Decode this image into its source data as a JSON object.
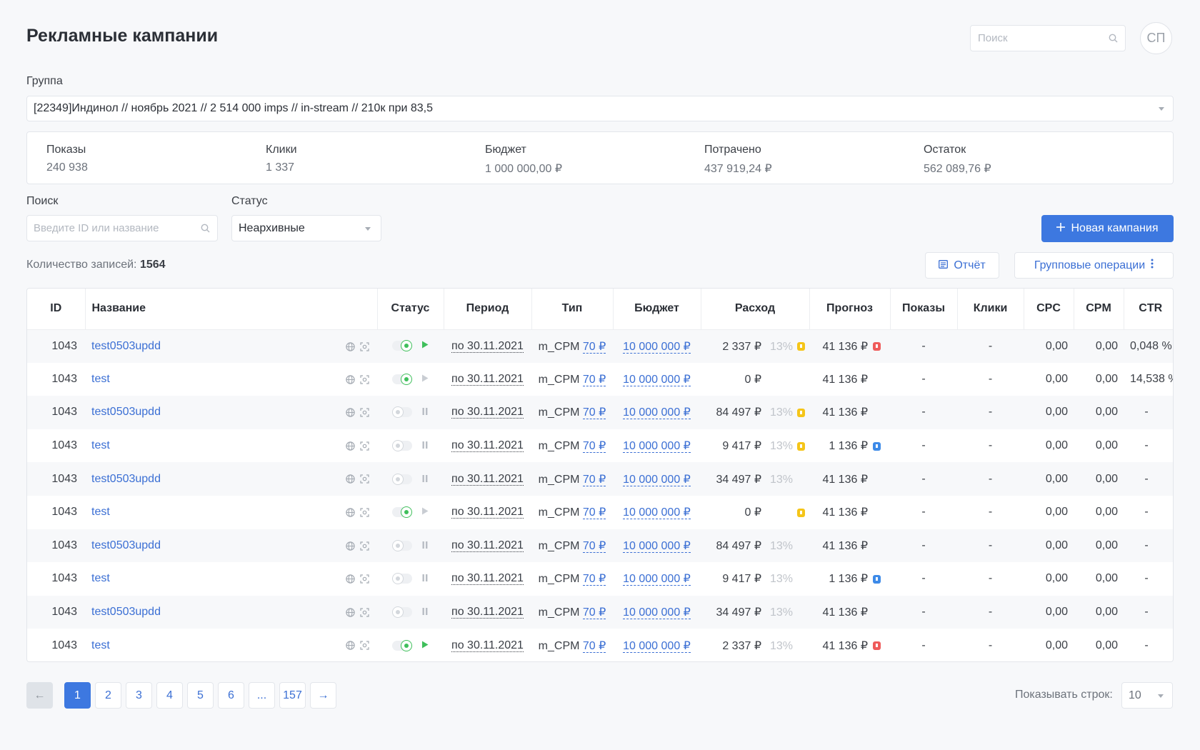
{
  "page": {
    "title": "Рекламные кампании"
  },
  "header": {
    "search_placeholder": "Поиск",
    "avatar_initials": "СП"
  },
  "group": {
    "label": "Группа",
    "value": "[22349]Индинол // ноябрь 2021 // 2 514 000 imps // in-stream // 210к при 83,5"
  },
  "stats": [
    {
      "label": "Показы",
      "value": "240 938"
    },
    {
      "label": "Клики",
      "value": "1 337"
    },
    {
      "label": "Бюджет",
      "value": "1 000 000,00 ₽"
    },
    {
      "label": "Потрачено",
      "value": "437 919,24 ₽"
    },
    {
      "label": "Остаток",
      "value": "562 089,76 ₽"
    }
  ],
  "filters": {
    "search_label": "Поиск",
    "search_placeholder": "Введите ID или название",
    "status_label": "Статус",
    "status_value": "Неархивные"
  },
  "actions": {
    "new_campaign": "Новая кампания",
    "report": "Отчёт",
    "group_ops": "Групповые операции"
  },
  "records": {
    "label": "Количество записей:",
    "count": "1564"
  },
  "table": {
    "columns": [
      "ID",
      "Название",
      "Статус",
      "Период",
      "Тип",
      "Бюджет",
      "Расход",
      "Прогноз",
      "Показы",
      "Клики",
      "CPC",
      "CPM",
      "CTR"
    ],
    "rows": [
      {
        "id": "1043",
        "name": "test0503updd",
        "active": true,
        "state": "play",
        "period": "по 30.11.2021",
        "type": "m_CPM",
        "rate": "70 ₽",
        "budget": "10 000 000 ₽",
        "spend": "2 337 ₽",
        "pct": "13%",
        "spend_flag": "yellow",
        "forecast": "41 136 ₽",
        "forecast_flag": "red",
        "shows": "-",
        "clicks": "-",
        "cpc": "0,00",
        "cpm": "0,00",
        "ctr": "0,048 %"
      },
      {
        "id": "1043",
        "name": "test",
        "active": true,
        "state": "play-muted",
        "period": "по 30.11.2021",
        "type": "m_CPM",
        "rate": "70 ₽",
        "budget": "10 000 000 ₽",
        "spend": "0 ₽",
        "pct": "",
        "spend_flag": "",
        "forecast": "41 136 ₽",
        "forecast_flag": "",
        "shows": "-",
        "clicks": "-",
        "cpc": "0,00",
        "cpm": "0,00",
        "ctr": "14,538 %"
      },
      {
        "id": "1043",
        "name": "test0503updd",
        "active": false,
        "state": "pause",
        "period": "по 30.11.2021",
        "type": "m_CPM",
        "rate": "70 ₽",
        "budget": "10 000 000 ₽",
        "spend": "84 497 ₽",
        "pct": "13%",
        "spend_flag": "yellow",
        "forecast": "41 136 ₽",
        "forecast_flag": "",
        "shows": "-",
        "clicks": "-",
        "cpc": "0,00",
        "cpm": "0,00",
        "ctr": "-"
      },
      {
        "id": "1043",
        "name": "test",
        "active": false,
        "state": "pause",
        "period": "по 30.11.2021",
        "type": "m_CPM",
        "rate": "70 ₽",
        "budget": "10 000 000 ₽",
        "spend": "9 417 ₽",
        "pct": "13%",
        "spend_flag": "yellow",
        "forecast": "1 136 ₽",
        "forecast_flag": "blue",
        "shows": "-",
        "clicks": "-",
        "cpc": "0,00",
        "cpm": "0,00",
        "ctr": "-"
      },
      {
        "id": "1043",
        "name": "test0503updd",
        "active": false,
        "state": "pause",
        "period": "по 30.11.2021",
        "type": "m_CPM",
        "rate": "70 ₽",
        "budget": "10 000 000 ₽",
        "spend": "34 497 ₽",
        "pct": "13%",
        "spend_flag": "",
        "forecast": "41 136 ₽",
        "forecast_flag": "",
        "shows": "-",
        "clicks": "-",
        "cpc": "0,00",
        "cpm": "0,00",
        "ctr": "-"
      },
      {
        "id": "1043",
        "name": "test",
        "active": true,
        "state": "play-muted",
        "period": "по 30.11.2021",
        "type": "m_CPM",
        "rate": "70 ₽",
        "budget": "10 000 000 ₽",
        "spend": "0 ₽",
        "pct": "",
        "spend_flag": "yellow",
        "forecast": "41 136 ₽",
        "forecast_flag": "",
        "shows": "-",
        "clicks": "-",
        "cpc": "0,00",
        "cpm": "0,00",
        "ctr": "-"
      },
      {
        "id": "1043",
        "name": "test0503updd",
        "active": false,
        "state": "pause",
        "period": "по 30.11.2021",
        "type": "m_CPM",
        "rate": "70 ₽",
        "budget": "10 000 000 ₽",
        "spend": "84 497 ₽",
        "pct": "13%",
        "spend_flag": "",
        "forecast": "41 136 ₽",
        "forecast_flag": "",
        "shows": "-",
        "clicks": "-",
        "cpc": "0,00",
        "cpm": "0,00",
        "ctr": "-"
      },
      {
        "id": "1043",
        "name": "test",
        "active": false,
        "state": "pause",
        "period": "по 30.11.2021",
        "type": "m_CPM",
        "rate": "70 ₽",
        "budget": "10 000 000 ₽",
        "spend": "9 417 ₽",
        "pct": "13%",
        "spend_flag": "",
        "forecast": "1 136 ₽",
        "forecast_flag": "blue",
        "shows": "-",
        "clicks": "-",
        "cpc": "0,00",
        "cpm": "0,00",
        "ctr": "-"
      },
      {
        "id": "1043",
        "name": "test0503updd",
        "active": false,
        "state": "pause",
        "period": "по 30.11.2021",
        "type": "m_CPM",
        "rate": "70 ₽",
        "budget": "10 000 000 ₽",
        "spend": "34 497 ₽",
        "pct": "13%",
        "spend_flag": "",
        "forecast": "41 136 ₽",
        "forecast_flag": "",
        "shows": "-",
        "clicks": "-",
        "cpc": "0,00",
        "cpm": "0,00",
        "ctr": "-"
      },
      {
        "id": "1043",
        "name": "test",
        "active": true,
        "state": "play",
        "period": "по 30.11.2021",
        "type": "m_CPM",
        "rate": "70 ₽",
        "budget": "10 000 000 ₽",
        "spend": "2 337 ₽",
        "pct": "13%",
        "spend_flag": "",
        "forecast": "41 136 ₽",
        "forecast_flag": "red",
        "shows": "-",
        "clicks": "-",
        "cpc": "0,00",
        "cpm": "0,00",
        "ctr": "-"
      }
    ]
  },
  "pagination": {
    "prev": "←",
    "next": "→",
    "pages": [
      "1",
      "2",
      "3",
      "4",
      "5",
      "6",
      "...",
      "157"
    ],
    "current": "1",
    "rows_label": "Показывать строк:",
    "rows_value": "10"
  },
  "colors": {
    "accent": "#3d78e0",
    "link": "#3b6fd4",
    "active_green": "#3fbf5b",
    "warn_yellow": "#f5c518",
    "error_red": "#ef5b5b",
    "info_blue": "#3d8ae8"
  }
}
